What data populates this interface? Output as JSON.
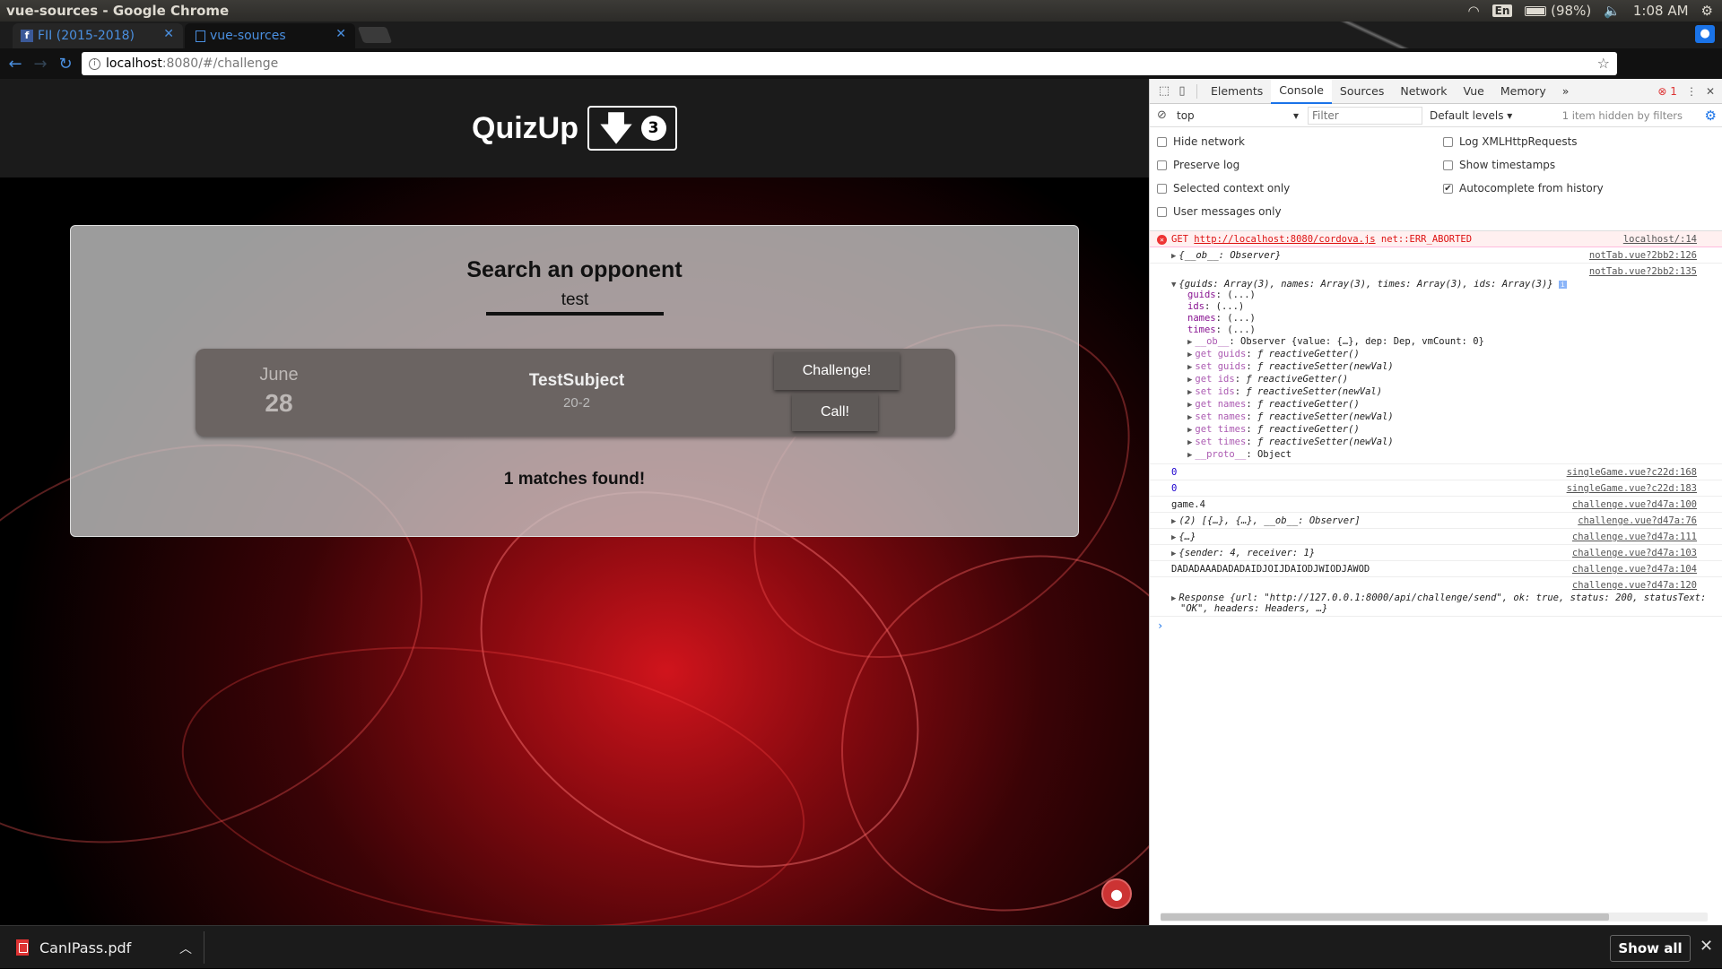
{
  "os": {
    "window_title": "vue-sources - Google Chrome",
    "keyboard_layout": "En",
    "battery": "(98%)",
    "battery_level": 0.98,
    "time": "1:08 AM"
  },
  "browser": {
    "tabs": [
      {
        "label": "FII (2015-2018)",
        "icon": "facebook-icon"
      },
      {
        "label": "vue-sources",
        "icon": "page-icon"
      }
    ],
    "url": {
      "host": "localhost",
      "path": ":8080/#/challenge"
    }
  },
  "app": {
    "brand": "QuizUp",
    "notification_count": "3",
    "search": {
      "title": "Search an opponent",
      "value": "test"
    },
    "match": {
      "month": "June",
      "day": "28",
      "opponent_name": "TestSubject",
      "score": "20-2",
      "challenge_label": "Challenge!",
      "call_label": "Call!"
    },
    "matches_found": "1 matches found!"
  },
  "devtools": {
    "tabs": [
      "Elements",
      "Console",
      "Sources",
      "Network",
      "Vue",
      "Memory"
    ],
    "active_tab": "Console",
    "error_count": "1",
    "context": "top",
    "filter_placeholder": "Filter",
    "levels": "Default levels",
    "hidden_note": "1 item hidden by filters",
    "settings": {
      "hide_network": "Hide network",
      "preserve_log": "Preserve log",
      "selected_context": "Selected context only",
      "user_messages": "User messages only",
      "log_xhr": "Log XMLHttpRequests",
      "show_timestamps": "Show timestamps",
      "autocomplete": "Autocomplete from history"
    },
    "console": {
      "err_get": "GET",
      "err_url": "http://localhost:8080/cordova.js",
      "err_msg": "net::ERR_ABORTED",
      "err_src": "localhost/:14",
      "l1": "{__ob__: Observer}",
      "l1_src": "notTab.vue?2bb2:126",
      "l2_src": "notTab.vue?2bb2:135",
      "l2_head": "{guids: Array(3), names: Array(3), times: Array(3), ids: Array(3)}",
      "p_guids": "guids",
      "p_ids": "ids",
      "p_names": "names",
      "p_times": "times",
      "p_ellipsis": "(...)",
      "p_ob": "__ob__",
      "p_ob_val": "Observer {value: {…}, dep: Dep, vmCount: 0}",
      "get_guids": "get guids",
      "set_guids": "set guids",
      "get_ids": "get ids",
      "set_ids": "set ids",
      "get_names": "get names",
      "set_names": "set names",
      "get_times": "get times",
      "set_times": "set times",
      "fn_get": "ƒ reactiveGetter()",
      "fn_set": "ƒ reactiveSetter(newVal)",
      "proto": "__proto__",
      "proto_val": "Object",
      "z1": "0",
      "z1_src": "singleGame.vue?c22d:168",
      "z2": "0",
      "z2_src": "singleGame.vue?c22d:183",
      "g4": "game.4",
      "g4_src": "challenge.vue?d47a:100",
      "arr": "(2) [{…}, {…}, __ob__: Observer]",
      "arr_src": "challenge.vue?d47a:76",
      "obj": "{…}",
      "obj_src": "challenge.vue?d47a:111",
      "sr": "{sender: 4, receiver: 1}",
      "sr_src": "challenge.vue?d47a:103",
      "dada": "DADADAAADADADAIDJOIJDAIODJWIODJAWOD",
      "dada_src": "challenge.vue?d47a:104",
      "resp_src": "challenge.vue?d47a:120",
      "resp1": "Response {url: \"http://127.0.0.1:8000/api/challenge/send\", ok: true, status: 200, statusText:",
      "resp2": "\"OK\", headers: Headers, …}"
    }
  },
  "downloads": {
    "file": "CanIPass.pdf",
    "show_all": "Show all"
  }
}
